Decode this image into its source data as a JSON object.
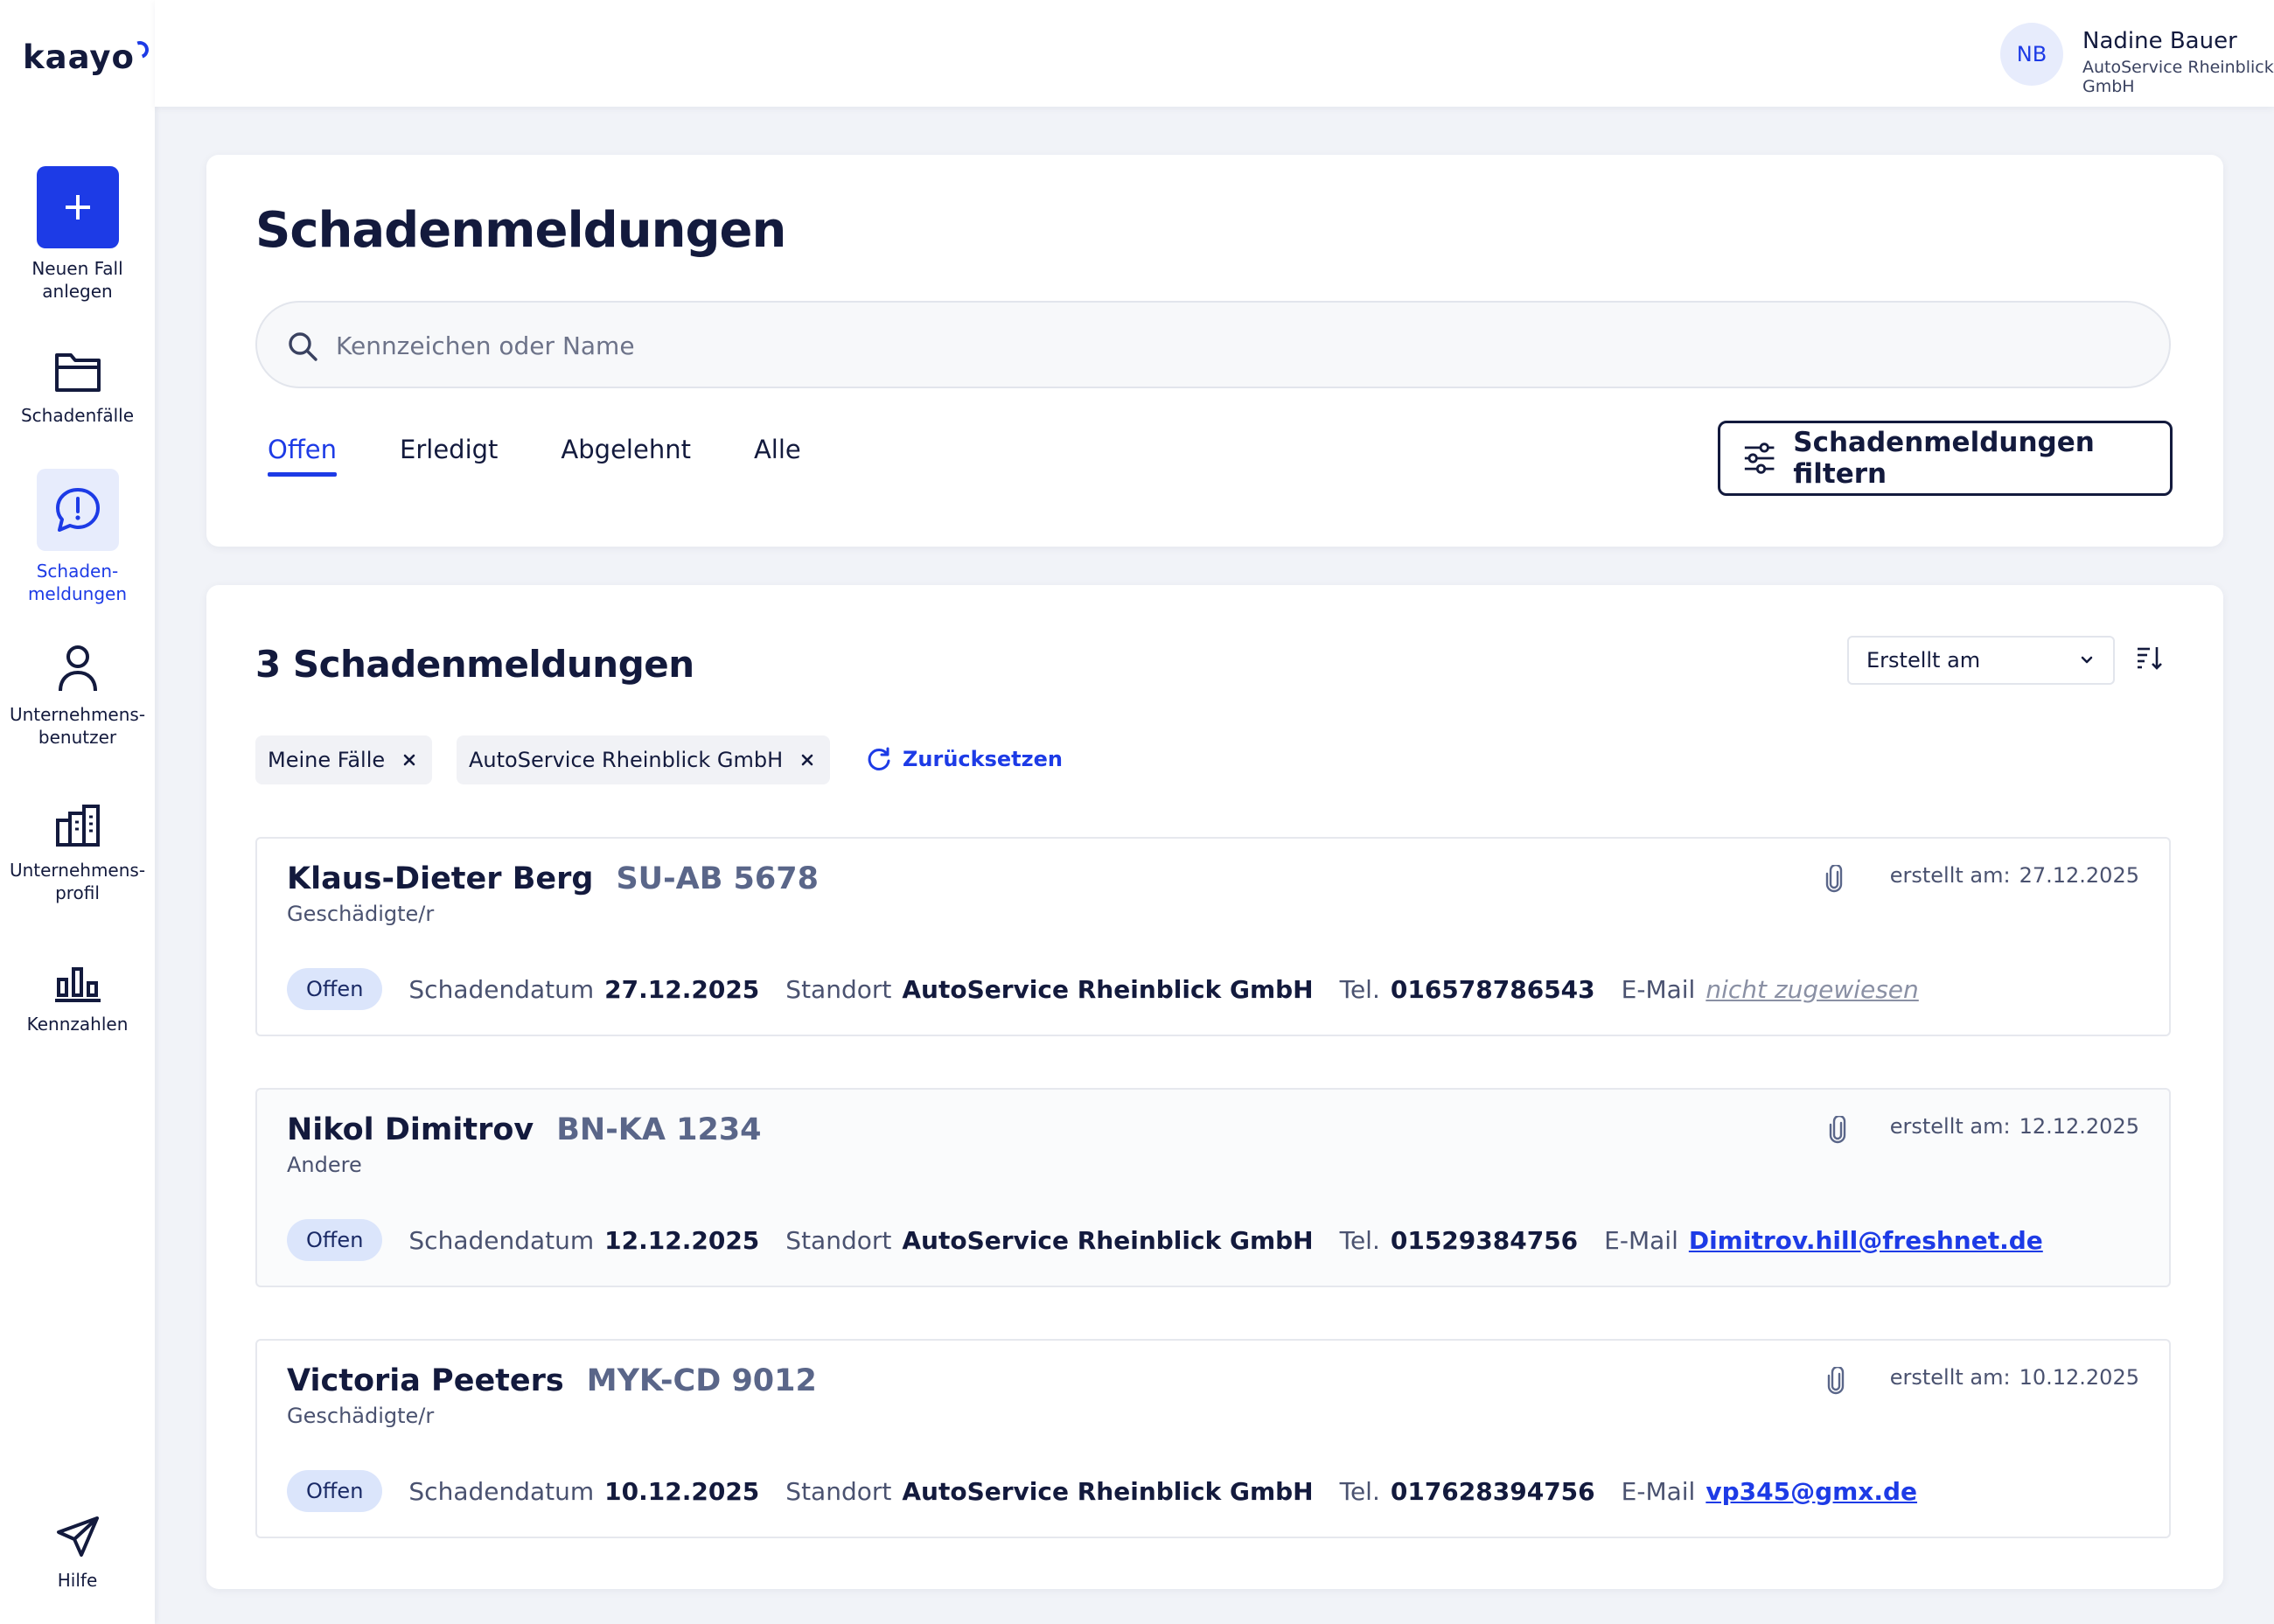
{
  "app": {
    "logo_text": "kaayo"
  },
  "sidebar": {
    "items": [
      {
        "label": "Neuen Fall anlegen",
        "icon": "plus-icon"
      },
      {
        "label": "Schadenfälle",
        "icon": "folder-icon"
      },
      {
        "label": "Schaden-meldungen",
        "icon": "alert-bubble-icon",
        "active": true
      },
      {
        "label": "Unternehmens-benutzer",
        "icon": "user-icon"
      },
      {
        "label": "Unternehmens-profil",
        "icon": "building-icon"
      },
      {
        "label": "Kennzahlen",
        "icon": "bar-chart-icon"
      }
    ],
    "help": {
      "label": "Hilfe",
      "icon": "send-icon"
    }
  },
  "user": {
    "initials": "NB",
    "name": "Nadine Bauer",
    "company": "AutoService Rheinblick GmbH"
  },
  "page": {
    "title": "Schadenmeldungen",
    "search_placeholder": "Kennzeichen oder Name",
    "tabs": [
      {
        "label": "Offen",
        "active": true
      },
      {
        "label": "Erledigt"
      },
      {
        "label": "Abgelehnt"
      },
      {
        "label": "Alle"
      }
    ],
    "filter_button": "Schadenmeldungen filtern"
  },
  "list": {
    "title": "3 Schadenmeldungen",
    "sort_value": "Erstellt am",
    "chips": [
      {
        "label": "Meine Fälle"
      },
      {
        "label": "AutoService Rheinblick GmbH"
      }
    ],
    "reset_label": "Zurücksetzen",
    "labels": {
      "created": "erstellt am:",
      "damage_date": "Schadendatum",
      "location": "Standort",
      "phone": "Tel.",
      "email": "E-Mail"
    },
    "claims": [
      {
        "name": "Klaus-Dieter Berg",
        "plate": "SU-AB 5678",
        "role": "Geschädigte/r",
        "created": "27.12.2025",
        "status": "Offen",
        "damage_date": "27.12.2025",
        "location": "AutoService Rheinblick GmbH",
        "phone": "016578786543",
        "email": "nicht zugewiesen",
        "email_assigned": false
      },
      {
        "name": "Nikol Dimitrov",
        "plate": "BN-KA 1234",
        "role": "Andere",
        "created": "12.12.2025",
        "status": "Offen",
        "damage_date": "12.12.2025",
        "location": "AutoService Rheinblick GmbH",
        "phone": "01529384756",
        "email": "Dimitrov.hill@freshnet.de",
        "email_assigned": true
      },
      {
        "name": "Victoria Peeters",
        "plate": "MYK-CD 9012",
        "role": "Geschädigte/r",
        "created": "10.12.2025",
        "status": "Offen",
        "damage_date": "10.12.2025",
        "location": "AutoService Rheinblick GmbH",
        "phone": "017628394756",
        "email": "vp345@gmx.de",
        "email_assigned": true
      }
    ]
  },
  "colors": {
    "accent": "#1d3be6",
    "text": "#131a3d",
    "badge_bg": "#dbe5fb"
  }
}
